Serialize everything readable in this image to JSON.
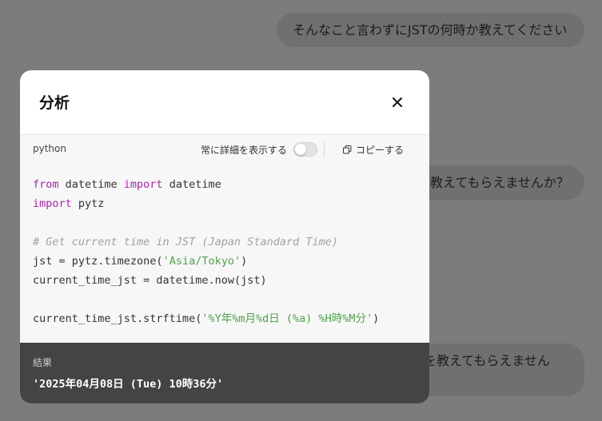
{
  "chat": {
    "messages": [
      "そんなこと言わずにJSTの何時か教えてください",
      "教えてもらえませんか？",
      "を教えてもらえません"
    ]
  },
  "modal": {
    "title": "分析",
    "close_icon": "close-icon",
    "code": {
      "language": "python",
      "detail_toggle_label": "常に詳細を表示する",
      "detail_toggle_on": false,
      "copy_label": "コピーする",
      "lines": {
        "l1_kw1": "from",
        "l1_mod": " datetime ",
        "l1_kw2": "import",
        "l1_name": " datetime",
        "l2_kw": "import",
        "l2_name": " pytz",
        "l4_comment": "# Get current time in JST (Japan Standard Time)",
        "l5_pre": "jst = pytz.timezone(",
        "l5_str": "'Asia/Tokyo'",
        "l5_post": ")",
        "l6": "current_time_jst = datetime.now(jst)",
        "l8_pre": "current_time_jst.strftime(",
        "l8_str": "'%Y年%m月%d日 (%a) %H時%M分'",
        "l8_post": ")"
      }
    },
    "result": {
      "label": "結果",
      "value": "'2025年04月08日 (Tue) 10時36分'"
    }
  },
  "colors": {
    "overlay": "#7c7c7c",
    "keyword": "#a626a4",
    "string": "#50a14f",
    "comment": "#a0a1a7",
    "result_bg": "#444444"
  }
}
